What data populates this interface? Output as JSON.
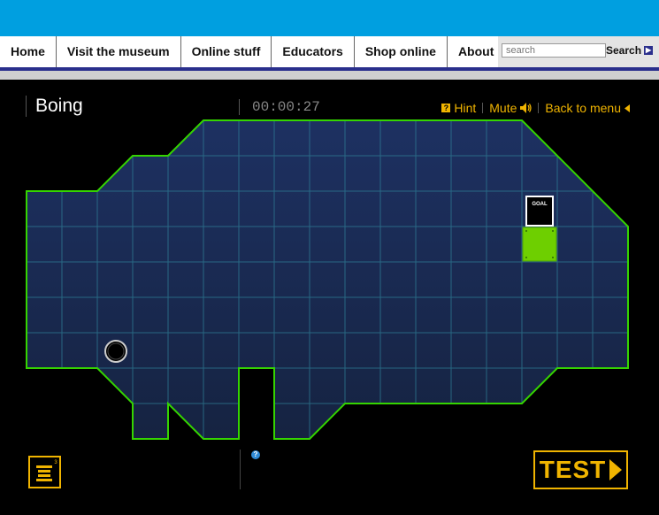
{
  "nav": {
    "items": [
      "Home",
      "Visit the museum",
      "Online stuff",
      "Educators",
      "Shop online",
      "About us"
    ],
    "search_placeholder": "search",
    "search_label": "Search"
  },
  "game": {
    "title": "Boing",
    "timer": "00:00:27",
    "hint_label": "Hint",
    "mute_label": "Mute",
    "back_label": "Back to menu",
    "goal_label": "GOAL",
    "test_label": "TEST",
    "help_glyph": "?",
    "hint_glyph": "?"
  },
  "colors": {
    "accent": "#f0b400",
    "border_green": "#35d400",
    "grid_line": "#2e7d95",
    "board_fill": "#1a2a52",
    "goal_green": "#6ecf00",
    "top_band": "#009fe0",
    "nav_underline": "#2a2f8c"
  }
}
